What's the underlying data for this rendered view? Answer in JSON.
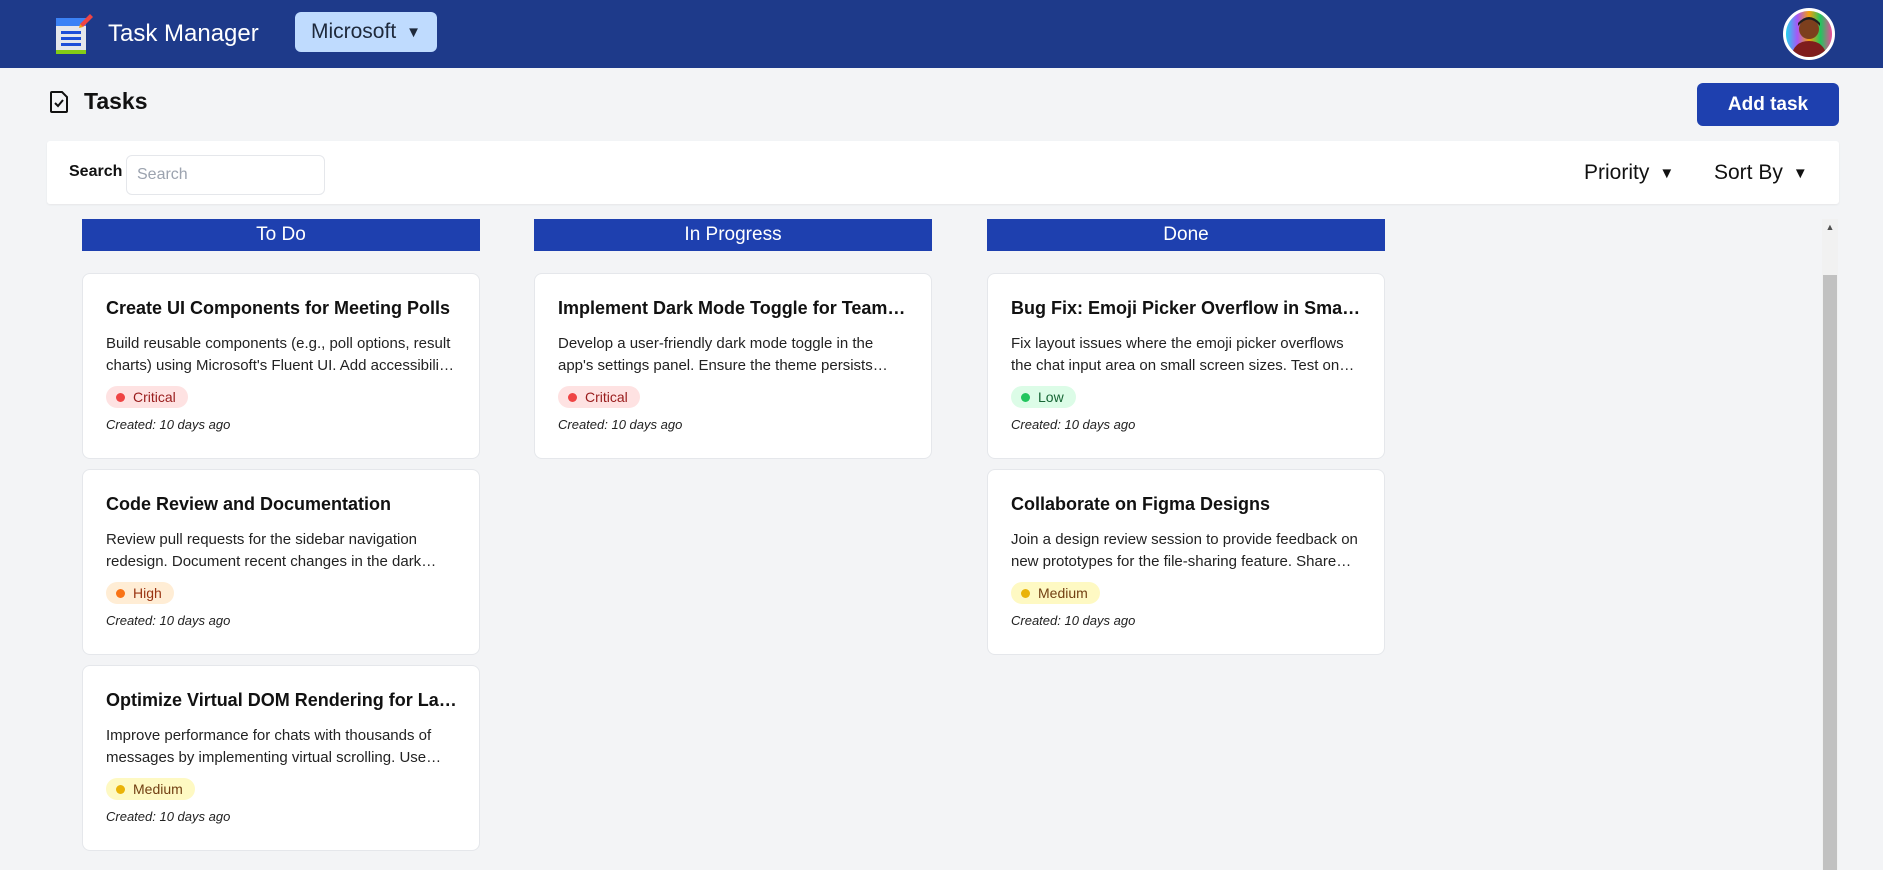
{
  "header": {
    "app_title": "Task Manager",
    "org_selector": "Microsoft",
    "logo_icon": "notepad-icon",
    "avatar_icon": "user-avatar"
  },
  "page": {
    "title": "Tasks",
    "title_icon": "clipboard-check-icon",
    "add_button": "Add task"
  },
  "filters": {
    "search_label": "Search",
    "search_placeholder": "Search",
    "search_value": "",
    "priority_label": "Priority",
    "sort_label": "Sort By"
  },
  "columns": [
    {
      "name": "To Do",
      "cards": [
        {
          "title": "Create UI Components for Meeting Polls",
          "description": "Build reusable components (e.g., poll options, result charts) using Microsoft's Fluent UI. Add accessibility support.",
          "priority": "Critical",
          "created": "Created: 10 days ago"
        },
        {
          "title": "Code Review and Documentation",
          "description": "Review pull requests for the sidebar navigation redesign. Document recent changes in the dark mode implementation.",
          "priority": "High",
          "created": "Created: 10 days ago"
        },
        {
          "title": "Optimize Virtual DOM Rendering for Large Chats",
          "description": "Improve performance for chats with thousands of messages by implementing virtual scrolling. Use windowing techniques.",
          "priority": "Medium",
          "created": "Created: 10 days ago"
        }
      ]
    },
    {
      "name": "In Progress",
      "cards": [
        {
          "title": "Implement Dark Mode Toggle for Teams Settings",
          "description": "Develop a user-friendly dark mode toggle in the app's settings panel. Ensure the theme persists across sessions.",
          "priority": "Critical",
          "created": "Created: 10 days ago"
        }
      ]
    },
    {
      "name": "Done",
      "cards": [
        {
          "title": "Bug Fix: Emoji Picker Overflow in Small Screens",
          "description": "Fix layout issues where the emoji picker overflows the chat input area on small screen sizes. Test on mobile.",
          "priority": "Low",
          "created": "Created: 10 days ago"
        },
        {
          "title": "Collaborate on Figma Designs",
          "description": "Join a design review session to provide feedback on new prototypes for the file-sharing feature. Share notes.",
          "priority": "Medium",
          "created": "Created: 10 days ago"
        }
      ]
    }
  ],
  "colors": {
    "topbar": "#1e3a8a",
    "accent": "#1e40af",
    "critical": "#ef4444",
    "high": "#f97316",
    "medium": "#eab308",
    "low": "#22c55e"
  }
}
